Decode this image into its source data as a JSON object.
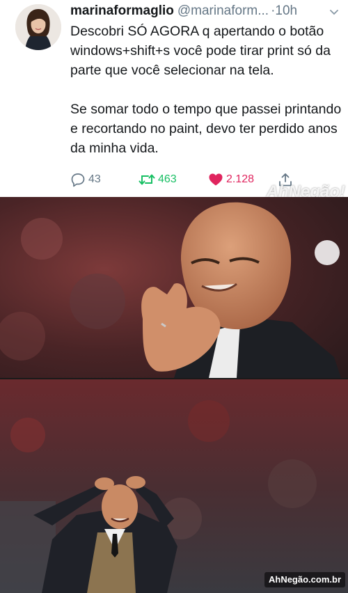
{
  "tweet": {
    "display_name": "marinaformaglio",
    "handle": "@marinaform...",
    "time": "·10h",
    "text_p1": "Descobri SÓ AGORA q apertando o botão windows+shift+s você pode tirar print só da parte que você selecionar na tela.",
    "text_p2": "Se somar todo o tempo que passei printando e recortando no paint, devo ter perdido anos da minha vida.",
    "replies": "43",
    "retweets": "463",
    "likes": "2.128"
  },
  "watermark_top": "AhNegão!",
  "watermark_bottom": "AhNegão.com.br",
  "colors": {
    "retweet": "#17bf63",
    "like": "#e0245e",
    "muted": "#657786"
  },
  "icons": [
    "chevron-down-icon",
    "reply-icon",
    "retweet-icon",
    "heart-icon",
    "share-icon"
  ]
}
